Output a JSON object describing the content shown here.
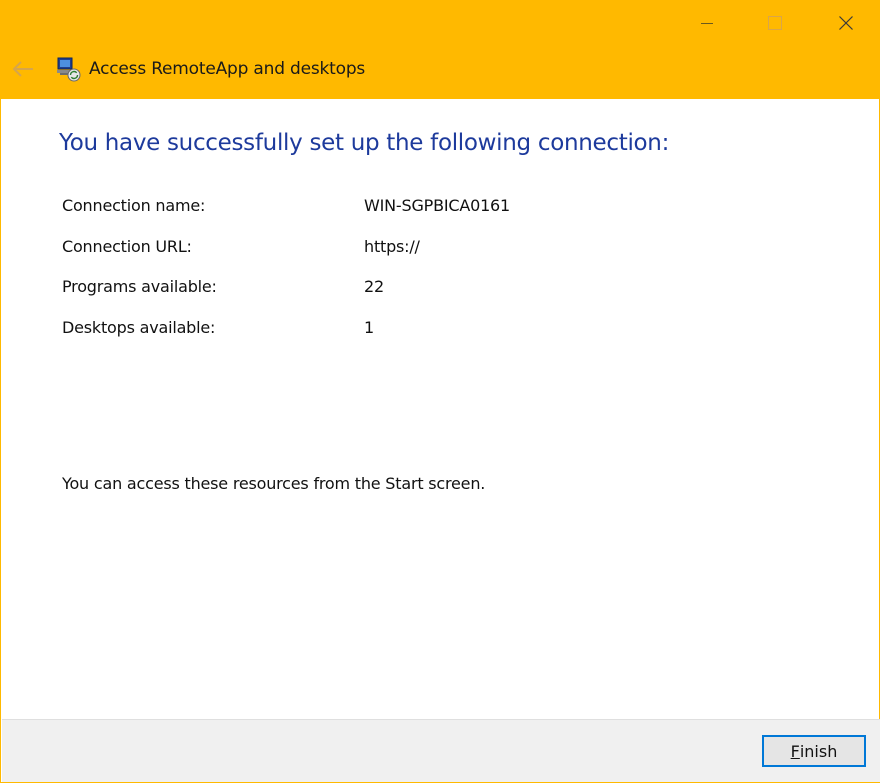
{
  "window": {
    "title": "Access RemoteApp and desktops",
    "accent_color": "#FFB900",
    "icons": {
      "back": "back-arrow-icon",
      "app": "remoteapp-icon",
      "minimize": "minimize-icon",
      "maximize": "maximize-icon",
      "close": "close-icon"
    }
  },
  "main": {
    "heading": "You have successfully set up the following connection:",
    "details": [
      {
        "label": "Connection name:",
        "value": "WIN-SGPBICA0161"
      },
      {
        "label": "Connection URL:",
        "value": "https://"
      },
      {
        "label": "Programs available:",
        "value": "22"
      },
      {
        "label": "Desktops available:",
        "value": "1"
      }
    ],
    "info": "You can access these resources from the Start screen."
  },
  "footer": {
    "finish_mnemonic": "F",
    "finish_rest": "inish"
  }
}
